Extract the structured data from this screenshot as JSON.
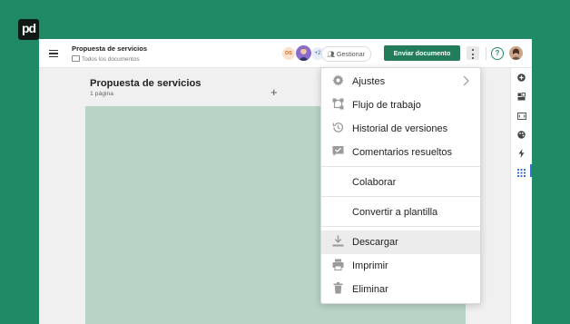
{
  "brand": {
    "logo_text": "pd"
  },
  "document": {
    "title": "Propuesta de servicios",
    "breadcrumb": "Todos los documentos",
    "page_heading": "Propuesta de servicios",
    "page_count": "1 página"
  },
  "collaborators": {
    "initials_badge": "DS",
    "extra_count": "+2",
    "manage_label": "Gestionar"
  },
  "toolbar": {
    "send_label": "Enviar documento",
    "help_label": "?"
  },
  "canvas": {
    "add_page_symbol": "+",
    "page_color": "#b9d4c7"
  },
  "colors": {
    "background": "#1f8a65",
    "primary_button": "#247d5a",
    "accent_blue": "#3b6fd9"
  },
  "menu": {
    "items": [
      {
        "label": "Ajustes",
        "icon": "gear-icon",
        "has_submenu": true
      },
      {
        "label": "Flujo de trabajo",
        "icon": "workflow-icon"
      },
      {
        "label": "Historial de versiones",
        "icon": "history-icon"
      },
      {
        "label": "Comentarios resueltos",
        "icon": "resolved-comments-icon"
      },
      {
        "label": "Colaborar"
      },
      {
        "label": "Convertir a plantilla"
      },
      {
        "label": "Descargar",
        "icon": "download-icon",
        "highlighted": true
      },
      {
        "label": "Imprimir",
        "icon": "print-icon"
      },
      {
        "label": "Eliminar",
        "icon": "trash-icon"
      }
    ]
  },
  "right_rail": {
    "items": [
      "add-icon",
      "blocks-icon",
      "variables-icon",
      "palette-icon",
      "lightning-icon",
      "apps-grid-icon"
    ],
    "active": "apps-grid-icon"
  }
}
